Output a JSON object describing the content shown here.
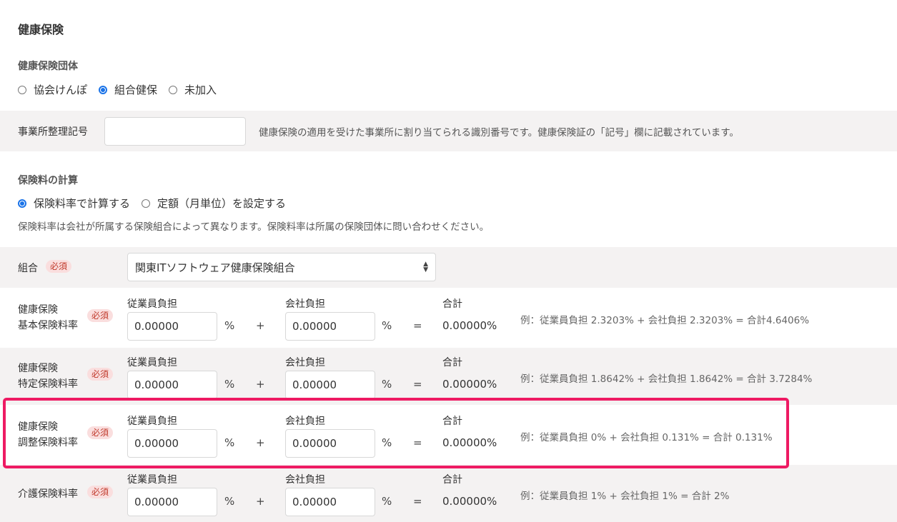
{
  "page_title": "健康保険",
  "insurance_group": {
    "heading": "健康保険団体",
    "options": [
      {
        "label": "協会けんぽ",
        "checked": false
      },
      {
        "label": "組合健保",
        "checked": true
      },
      {
        "label": "未加入",
        "checked": false
      }
    ]
  },
  "office_symbol": {
    "label": "事業所整理記号",
    "value": "",
    "help": "健康保険の適用を受けた事業所に割り当てられる識別番号です。健康保険証の「記号」欄に記載されています。"
  },
  "calculation": {
    "heading": "保険料の計算",
    "options": [
      {
        "label": "保険料率で計算する",
        "checked": true
      },
      {
        "label": "定額（月単位）を設定する",
        "checked": false
      }
    ],
    "note": "保険料率は会社が所属する保険組合によって異なります。保険料率は所属の保険団体に問い合わせください。"
  },
  "union": {
    "label": "組合",
    "required": "必須",
    "selected": "関東ITソフトウェア健康保険組合"
  },
  "columns": {
    "employee": "従業員負担",
    "company": "会社負担",
    "total": "合計"
  },
  "symbols": {
    "percent": "%",
    "plus": "+",
    "equals": "="
  },
  "rates": [
    {
      "label_line1": "健康保険",
      "label_line2": "基本保険料率",
      "required": "必須",
      "employee": "0.00000",
      "company": "0.00000",
      "total": "0.00000%",
      "example": "例：従業員負担 2.3203% + 会社負担 2.3203% = 合計4.6406%"
    },
    {
      "label_line1": "健康保険",
      "label_line2": "特定保険料率",
      "required": "必須",
      "employee": "0.00000",
      "company": "0.00000",
      "total": "0.00000%",
      "example": "例：従業員負担 1.8642% + 会社負担 1.8642% = 合計 3.7284%"
    },
    {
      "label_line1": "健康保険",
      "label_line2": "調整保険料率",
      "required": "必須",
      "employee": "0.00000",
      "company": "0.00000",
      "total": "0.00000%",
      "example": "例：従業員負担 0% + 会社負担 0.131% = 合計 0.131%"
    },
    {
      "label_line1": "介護保険料率",
      "label_line2": "",
      "required": "必須",
      "employee": "0.00000",
      "company": "0.00000",
      "total": "0.00000%",
      "example": "例：従業員負担 1% + 会社負担 1% = 合計 2%"
    }
  ],
  "colors": {
    "accent": "#1a73e8",
    "highlight": "#ee1a63",
    "band": "#f4f2f2",
    "badge_bg": "#fadede",
    "badge_text": "#c0392b"
  }
}
